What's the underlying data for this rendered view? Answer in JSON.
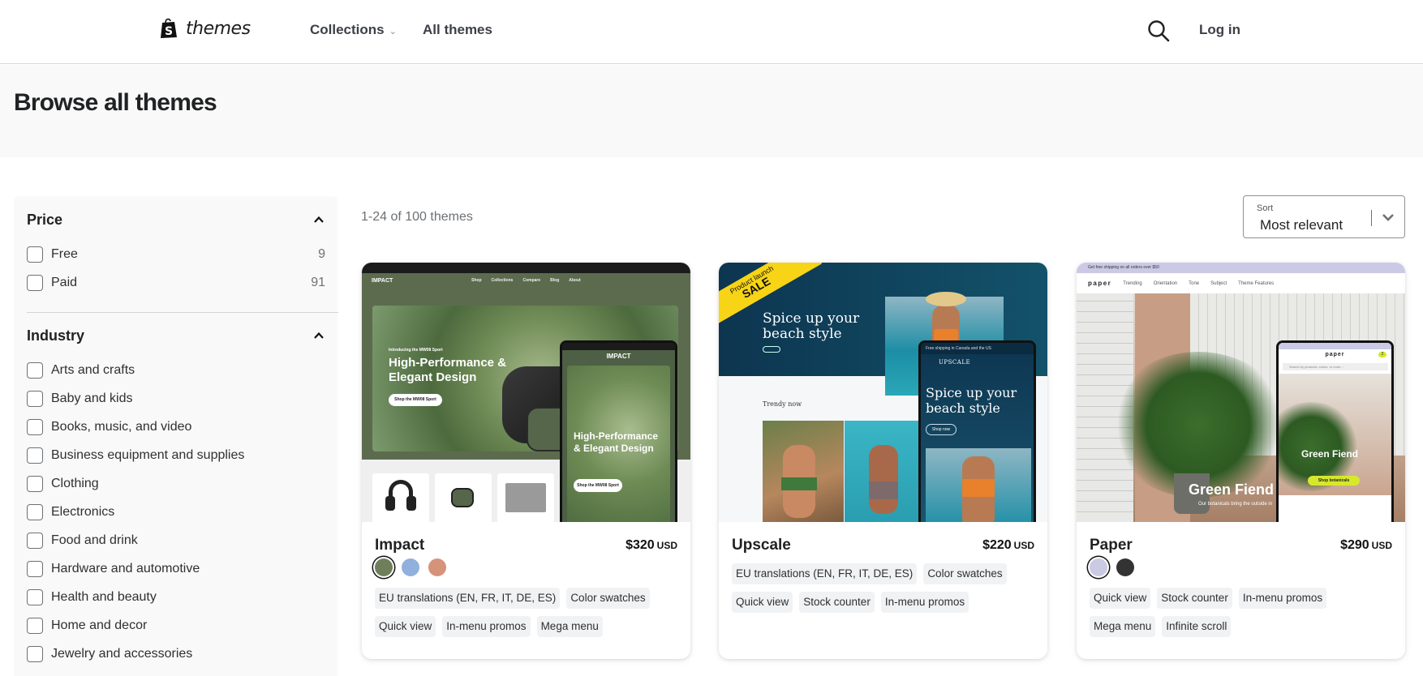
{
  "header": {
    "logo_text": "themes",
    "nav": [
      {
        "label": "Collections",
        "has_dropdown": true
      },
      {
        "label": "All themes",
        "has_dropdown": false
      }
    ],
    "search_icon": "search-icon",
    "login_label": "Log in"
  },
  "page": {
    "title": "Browse all themes"
  },
  "filters": {
    "price": {
      "title": "Price",
      "expanded": true,
      "options": [
        {
          "label": "Free",
          "count": "9",
          "checked": false
        },
        {
          "label": "Paid",
          "count": "91",
          "checked": false
        }
      ]
    },
    "industry": {
      "title": "Industry",
      "expanded": true,
      "options": [
        {
          "label": "Arts and crafts",
          "checked": false
        },
        {
          "label": "Baby and kids",
          "checked": false
        },
        {
          "label": "Books, music, and video",
          "checked": false
        },
        {
          "label": "Business equipment and supplies",
          "checked": false
        },
        {
          "label": "Clothing",
          "checked": false
        },
        {
          "label": "Electronics",
          "checked": false
        },
        {
          "label": "Food and drink",
          "checked": false
        },
        {
          "label": "Hardware and automotive",
          "checked": false
        },
        {
          "label": "Health and beauty",
          "checked": false
        },
        {
          "label": "Home and decor",
          "checked": false
        },
        {
          "label": "Jewelry and accessories",
          "checked": false
        }
      ]
    }
  },
  "results": {
    "count_text": "1-24 of 100 themes",
    "sort": {
      "label": "Sort",
      "value": "Most relevant"
    }
  },
  "themes": [
    {
      "name": "Impact",
      "price": "$320",
      "currency": "USD",
      "swatches": [
        {
          "color": "#6f7f5c",
          "selected": true
        },
        {
          "color": "#92b0dd",
          "selected": false
        },
        {
          "color": "#d6937a",
          "selected": false
        }
      ],
      "tags": [
        "EU translations (EN, FR, IT, DE, ES)",
        "Color swatches",
        "Quick view",
        "In-menu promos",
        "Mega menu"
      ],
      "preview": {
        "brand": "IMPACT",
        "nav_items": [
          "Shop",
          "Collections",
          "Compare",
          "Blog",
          "About"
        ],
        "eyebrow": "Introducing the MW08 Sport",
        "headline": "High-Performance & Elegant Design",
        "cta": "Shop the MW08 Sport",
        "products": [
          "Headphones",
          "Earphones",
          "Speakers"
        ]
      }
    },
    {
      "name": "Upscale",
      "price": "$220",
      "currency": "USD",
      "swatches": [],
      "tags": [
        "EU translations (EN, FR, IT, DE, ES)",
        "Color swatches",
        "Quick view",
        "Stock counter",
        "In-menu promos"
      ],
      "preview": {
        "badge_line1": "Product launch",
        "badge_line2": "SALE",
        "brand": "UPSCALE",
        "announcement": "Free shipping in Canada and the US",
        "headline": "Spice up your beach style",
        "cta": "Shop now",
        "section": "Trendy now"
      }
    },
    {
      "name": "Paper",
      "price": "$290",
      "currency": "USD",
      "swatches": [
        {
          "color": "#cbcae3",
          "selected": true
        },
        {
          "color": "#333333",
          "selected": false
        }
      ],
      "tags": [
        "Quick view",
        "Stock counter",
        "In-menu promos",
        "Mega menu",
        "Infinite scroll"
      ],
      "preview": {
        "announcement": "Get free shipping on all orders over $50",
        "brand": "paper",
        "nav_items": [
          "Trending",
          "Orientation",
          "Tone",
          "Subject",
          "Theme Features"
        ],
        "search_placeholder": "Search by products, colors, or more...",
        "headline": "Green Fiend",
        "subline": "Our botanicals bring the outside in",
        "cta": "Shop botanicals",
        "cart_count": "2"
      }
    }
  ]
}
